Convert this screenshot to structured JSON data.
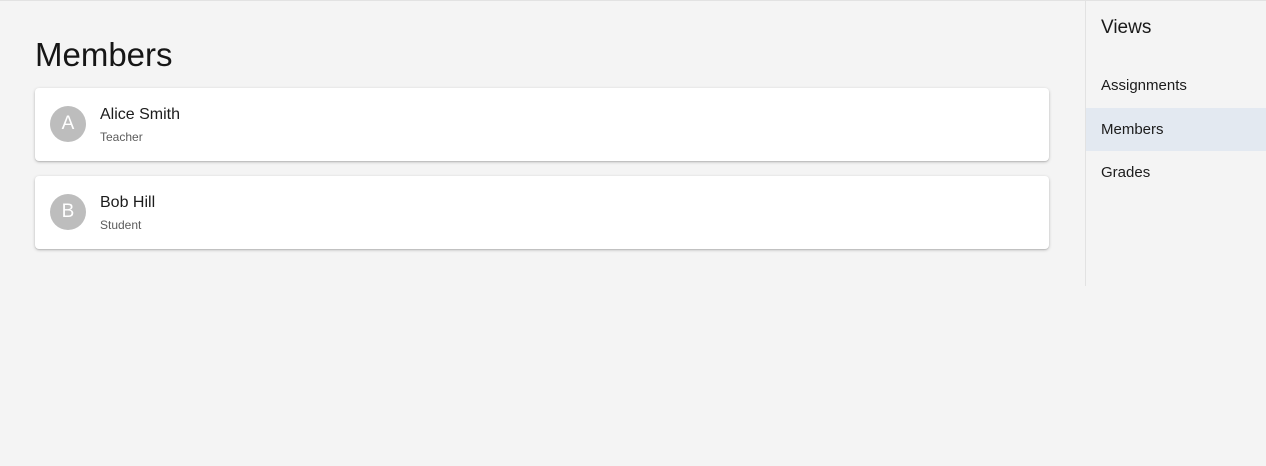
{
  "main": {
    "title": "Members",
    "members": [
      {
        "initial": "A",
        "name": "Alice Smith",
        "role": "Teacher"
      },
      {
        "initial": "B",
        "name": "Bob Hill",
        "role": "Student"
      }
    ]
  },
  "sidebar": {
    "title": "Views",
    "items": [
      {
        "label": "Assignments",
        "active": false
      },
      {
        "label": "Members",
        "active": true
      },
      {
        "label": "Grades",
        "active": false
      }
    ]
  },
  "colors": {
    "background": "#f4f4f4",
    "card": "#ffffff",
    "avatar": "#bdbdbd",
    "active_nav": "#e3e9f1"
  }
}
